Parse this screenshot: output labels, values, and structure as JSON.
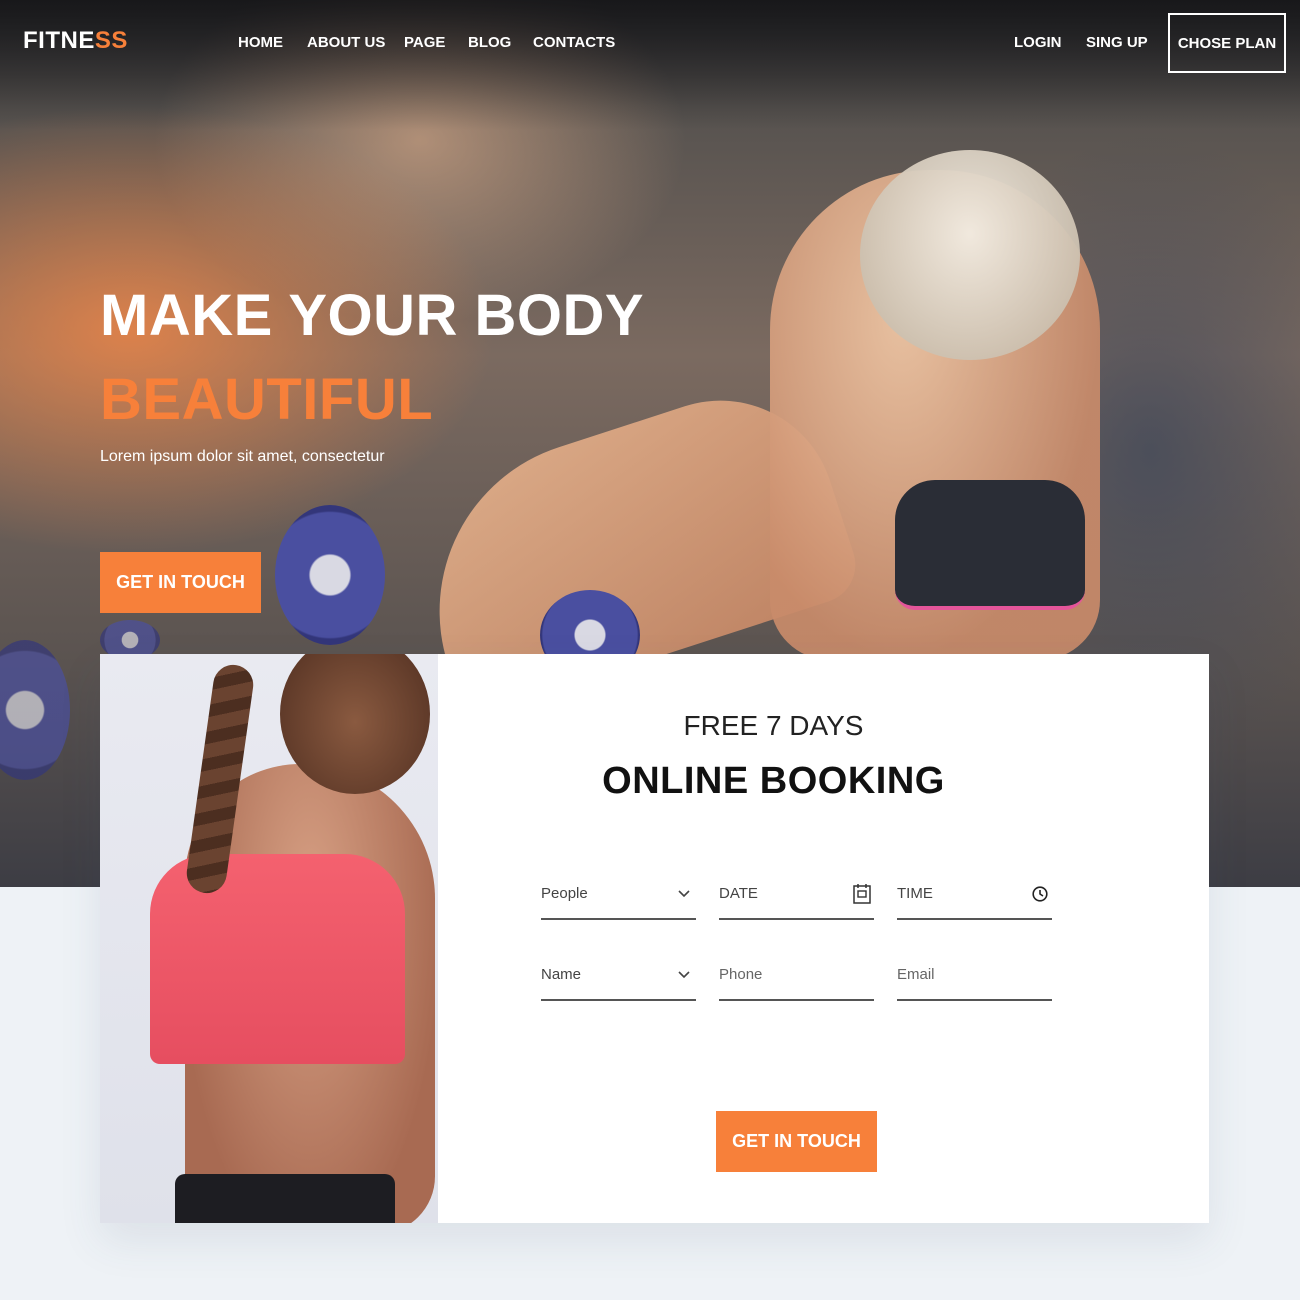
{
  "brand": {
    "logo_main": "FITNE",
    "logo_accent": "SS"
  },
  "nav": {
    "links": [
      "HOME",
      "ABOUT US",
      "PAGE",
      "BLOG",
      "CONTACTS"
    ],
    "login": "LOGIN",
    "signup": "SING UP",
    "plan_button": "CHOSE PLAN"
  },
  "hero": {
    "title": "MAKE YOUR BODY",
    "title_accent": "BEAUTIFUL",
    "subtitle": "Lorem ipsum dolor sit amet, consectetur",
    "cta": "GET IN TOUCH"
  },
  "booking": {
    "subtitle": "FREE 7 DAYS",
    "title": "ONLINE BOOKING",
    "fields": {
      "people": {
        "label": "People",
        "icon": "chevron-down-icon"
      },
      "date": {
        "label": "DATE",
        "icon": "calendar-icon"
      },
      "time": {
        "label": "TIME",
        "icon": "clock-icon"
      },
      "name": {
        "label": "Name",
        "icon": "chevron-down-icon"
      },
      "phone": {
        "placeholder": "Phone"
      },
      "email": {
        "placeholder": "Email"
      }
    },
    "cta": "GET IN TOUCH"
  },
  "colors": {
    "accent": "#f7803a",
    "text_dark": "#111111",
    "page_bg": "#eef2f6"
  }
}
